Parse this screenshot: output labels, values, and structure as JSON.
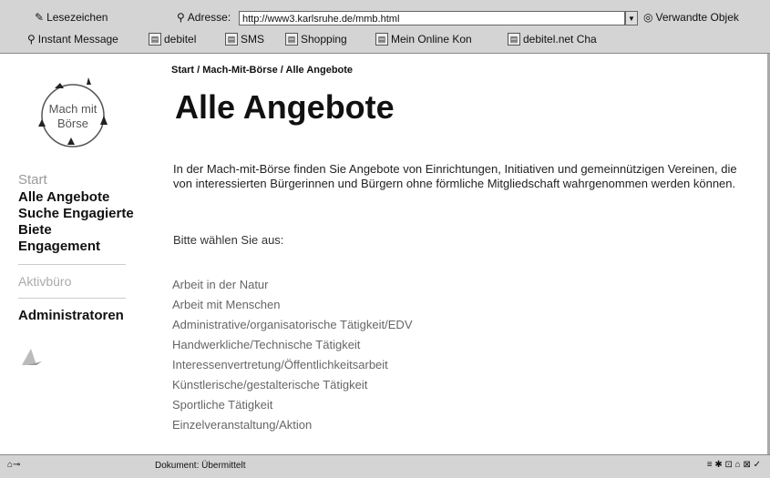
{
  "browser": {
    "bookmarks_label": "Lesezeichen",
    "address_label": "Adresse:",
    "address_value": "http://www3.karlsruhe.de/mmb.html",
    "related_label": "Verwandte Objek",
    "personal_bar": [
      "Instant Message",
      "debitel",
      "SMS",
      "Shopping",
      "Mein Online Kon",
      "debitel.net Cha"
    ]
  },
  "logo": {
    "line1": "Mach mit",
    "line2": "Börse"
  },
  "sidebar": {
    "start": "Start",
    "items": [
      "Alle Angebote",
      "Suche Engagierte",
      "Biete",
      "Engagement"
    ],
    "aktiv": "Aktivbüro",
    "admin": "Administratoren"
  },
  "main": {
    "breadcrumb": "Start / Mach-Mit-Börse / Alle Angebote",
    "title": "Alle Angebote",
    "intro": "In der Mach-mit-Börse finden Sie Angebote von Einrichtungen, Initiativen und gemeinnützigen Vereinen, die von interessierten Bürgerinnen und Bürgern ohne förmliche Mitgliedschaft wahrgenommen werden können.",
    "choose": "Bitte wählen Sie aus:",
    "categories": [
      "Arbeit in der Natur",
      "Arbeit mit Menschen",
      "Administrative/organisatorische Tätigkeit/EDV",
      "Handwerkliche/Technische Tätigkeit",
      "Interessenvertretung/Öffentlichkeitsarbeit",
      "Künstlerische/gestalterische Tätigkeit",
      "Sportliche Tätigkeit",
      "Einzelveranstaltung/Aktion"
    ]
  },
  "status": {
    "text": "Dokument: Übermittelt"
  }
}
